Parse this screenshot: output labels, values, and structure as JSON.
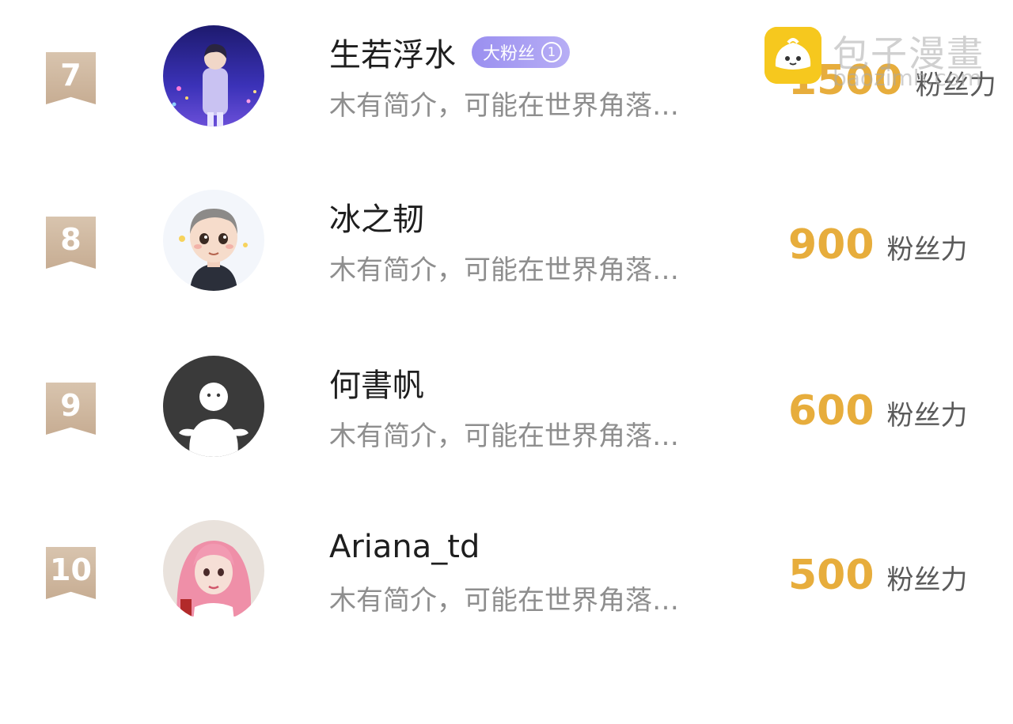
{
  "rows": [
    {
      "rank": "7",
      "name": "生若浮水",
      "badge_label": "大粉丝",
      "badge_level": "1",
      "bio": "木有简介，可能在世界角落…",
      "score": "1500",
      "score_unit": "粉丝力",
      "avatar": "night-city-boy-avatar"
    },
    {
      "rank": "8",
      "name": "冰之韧",
      "bio": "木有简介，可能在世界角落…",
      "score": "900",
      "score_unit": "粉丝力",
      "avatar": "cartoon-man-avatar"
    },
    {
      "rank": "9",
      "name": "何書帆",
      "bio": "木有简介，可能在世界角落…",
      "score": "600",
      "score_unit": "粉丝力",
      "avatar": "default-ghost-avatar"
    },
    {
      "rank": "10",
      "name": "Ariana_td",
      "bio": "木有简介，可能在世界角落…",
      "score": "500",
      "score_unit": "粉丝力",
      "avatar": "pink-hair-girl-avatar"
    }
  ],
  "watermark": {
    "title": "包子漫畫",
    "url": "baozimh.com",
    "logo": "bun-logo-icon"
  },
  "colors": {
    "score": "#e7ad3c",
    "rank_badge": "#c7ad93",
    "fan_badge": "#9a8ff0",
    "bio": "#8e8e8e",
    "watermark_logo": "#f6c81e"
  }
}
